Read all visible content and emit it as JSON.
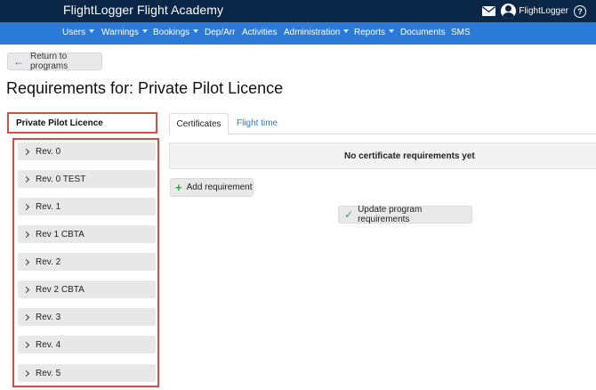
{
  "header": {
    "brand": "FlightLogger Flight Academy",
    "username": "FlightLogger",
    "help_glyph": "?",
    "icons": [
      "envelope-icon",
      "avatar-icon",
      "help-icon"
    ]
  },
  "nav": {
    "items": [
      {
        "label": "Users",
        "dropdown": true
      },
      {
        "label": "Warnings",
        "dropdown": true
      },
      {
        "label": "Bookings",
        "dropdown": true
      },
      {
        "label": "Dep/Arr",
        "dropdown": false
      },
      {
        "label": "Activities",
        "dropdown": false
      },
      {
        "label": "Administration",
        "dropdown": true
      },
      {
        "label": "Reports",
        "dropdown": true
      },
      {
        "label": "Documents",
        "dropdown": false
      },
      {
        "label": "SMS",
        "dropdown": false
      }
    ]
  },
  "back_button": {
    "label": "Return to programs",
    "icon": "arrow-left-icon"
  },
  "page_title": "Requirements for: Private Pilot Licence",
  "program": {
    "name": "Private Pilot Licence"
  },
  "revisions": [
    {
      "label": "Rev. 0"
    },
    {
      "label": "Rev. 0 TEST"
    },
    {
      "label": "Rev. 1"
    },
    {
      "label": "Rev 1 CBTA"
    },
    {
      "label": "Rev. 2"
    },
    {
      "label": "Rev 2 CBTA"
    },
    {
      "label": "Rev. 3"
    },
    {
      "label": "Rev. 4"
    },
    {
      "label": "Rev. 5"
    }
  ],
  "tabs": [
    {
      "label": "Certificates",
      "active": true
    },
    {
      "label": "Flight time",
      "active": false
    }
  ],
  "certificates": {
    "empty_message": "No certificate requirements yet",
    "add_button": "Add requirement",
    "update_button": "Update program requirements"
  },
  "colors": {
    "topbar": "#0b2747",
    "navbar": "#2b7ad8",
    "highlight_border": "#dc4b46",
    "success_icon": "#3aa14a",
    "link": "#2b7ad8"
  }
}
